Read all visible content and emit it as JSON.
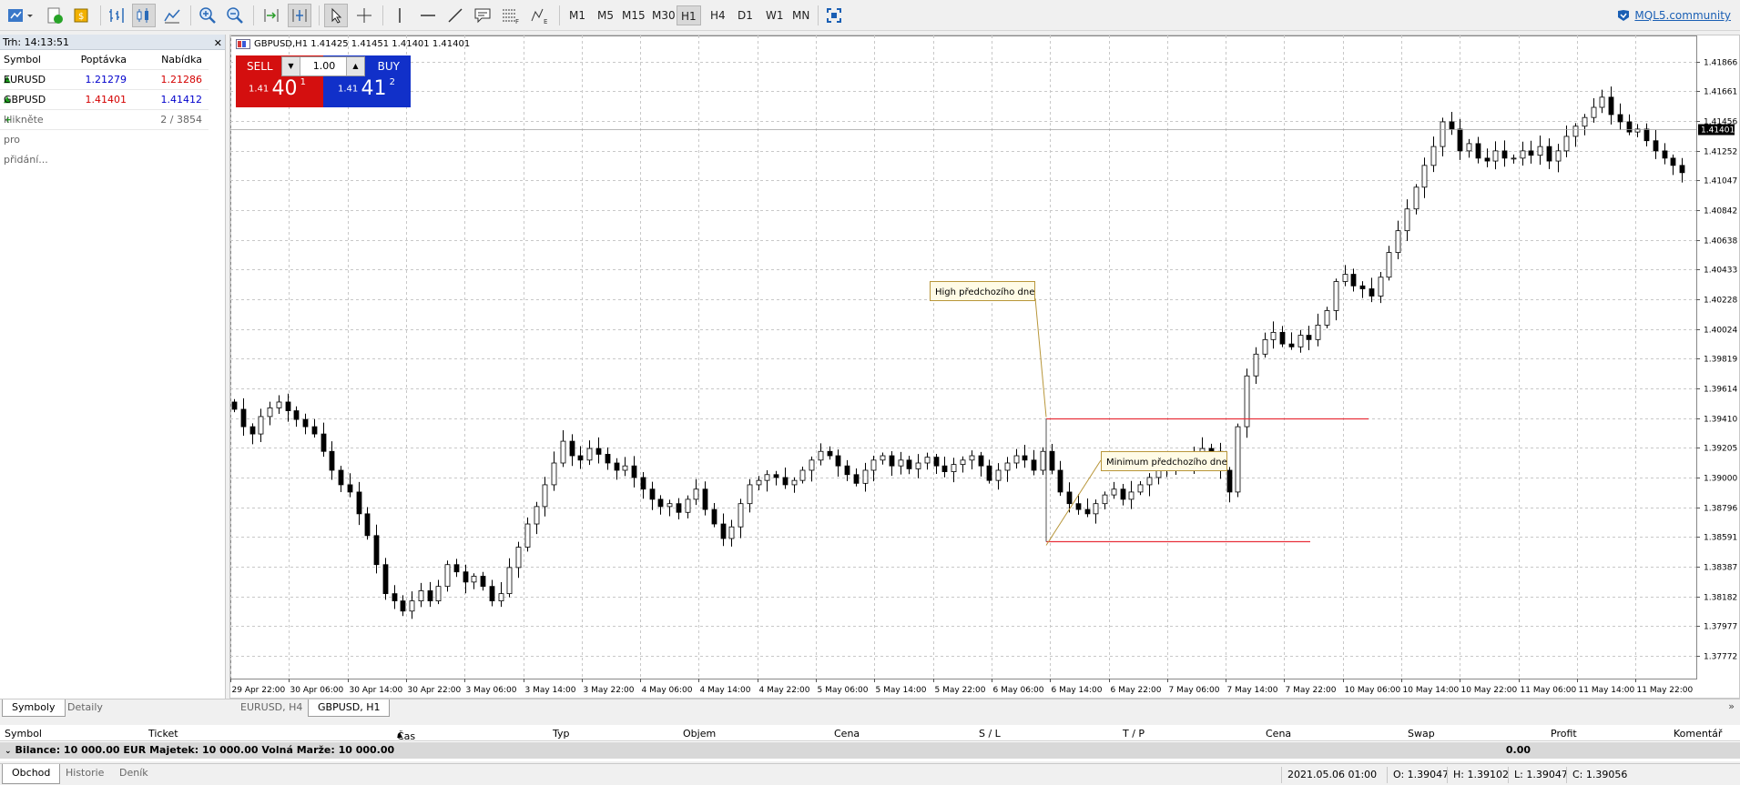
{
  "toolbar": {
    "timeframes": [
      "M1",
      "M5",
      "M15",
      "M30",
      "H1",
      "H4",
      "D1",
      "W1",
      "MN"
    ],
    "active_timeframe": "H1",
    "mql5_link": "MQL5.community"
  },
  "market_watch": {
    "title": "Trh: 14:13:51",
    "columns": [
      "Symbol",
      "Poptávka",
      "Nabídka"
    ],
    "rows": [
      {
        "symbol": "EURUSD",
        "bid": "1.21279",
        "ask": "1.21286"
      },
      {
        "symbol": "GBPUSD",
        "bid": "1.41401",
        "ask": "1.41412"
      }
    ],
    "add_text": "klikněte pro přidání...",
    "count": "2 / 3854"
  },
  "chart": {
    "header": "GBPUSD,H1  1.41425 1.41451 1.41401 1.41401",
    "sell_label": "SELL",
    "buy_label": "BUY",
    "lot": "1.00",
    "sell_prefix": "1.41",
    "sell_big": "40",
    "sell_sup": "1",
    "buy_prefix": "1.41",
    "buy_big": "41",
    "buy_sup": "2",
    "annotation_high": "High předchozího dne",
    "annotation_low": "Minimum předchozího dne"
  },
  "chart_data": {
    "type": "candlestick",
    "symbol": "GBPUSD",
    "timeframe": "H1",
    "current_price": "1.41401",
    "y_ticks": [
      "1.41866",
      "1.41661",
      "1.41456",
      "1.41252",
      "1.41047",
      "1.40842",
      "1.40638",
      "1.40433",
      "1.40228",
      "1.40024",
      "1.39819",
      "1.39614",
      "1.39410",
      "1.39205",
      "1.39000",
      "1.38796",
      "1.38591",
      "1.38387",
      "1.38182",
      "1.37977",
      "1.37772"
    ],
    "ylim": [
      1.37615,
      1.42045
    ],
    "x_ticks": [
      "29 Apr 22:00",
      "30 Apr 06:00",
      "30 Apr 14:00",
      "30 Apr 22:00",
      "3 May 06:00",
      "3 May 14:00",
      "3 May 22:00",
      "4 May 06:00",
      "4 May 14:00",
      "4 May 22:00",
      "5 May 06:00",
      "5 May 14:00",
      "5 May 22:00",
      "6 May 06:00",
      "6 May 14:00",
      "6 May 22:00",
      "7 May 06:00",
      "7 May 14:00",
      "7 May 22:00",
      "10 May 06:00",
      "10 May 14:00",
      "10 May 22:00",
      "11 May 06:00",
      "11 May 14:00",
      "11 May 22:00"
    ],
    "prev_day_high": 1.3941,
    "prev_day_low": 1.3856,
    "closes": [
      1.3947,
      1.3935,
      1.393,
      1.3942,
      1.3948,
      1.3952,
      1.3946,
      1.394,
      1.3935,
      1.393,
      1.3918,
      1.3905,
      1.3895,
      1.389,
      1.3875,
      1.386,
      1.384,
      1.382,
      1.3815,
      1.3808,
      1.3815,
      1.3822,
      1.3815,
      1.3825,
      1.384,
      1.3835,
      1.3828,
      1.3832,
      1.3825,
      1.3815,
      1.382,
      1.3838,
      1.3852,
      1.3868,
      1.388,
      1.3895,
      1.391,
      1.3925,
      1.3915,
      1.3912,
      1.392,
      1.3916,
      1.391,
      1.3905,
      1.3908,
      1.39,
      1.3892,
      1.3885,
      1.388,
      1.3882,
      1.3876,
      1.3885,
      1.3892,
      1.3878,
      1.3868,
      1.3858,
      1.3866,
      1.3882,
      1.3895,
      1.3898,
      1.3902,
      1.39,
      1.3895,
      1.3898,
      1.3905,
      1.3912,
      1.3918,
      1.3915,
      1.3908,
      1.3902,
      1.3896,
      1.3905,
      1.3912,
      1.3915,
      1.3908,
      1.3912,
      1.3906,
      1.391,
      1.3914,
      1.3908,
      1.3904,
      1.3909,
      1.3912,
      1.3915,
      1.3908,
      1.3898,
      1.3905,
      1.391,
      1.3915,
      1.3912,
      1.3905,
      1.3918,
      1.3905,
      1.389,
      1.3882,
      1.3878,
      1.3875,
      1.3882,
      1.3888,
      1.3892,
      1.3885,
      1.389,
      1.3895,
      1.39,
      1.3905,
      1.3908,
      1.3912,
      1.391,
      1.3915,
      1.392,
      1.3918,
      1.3905,
      1.389,
      1.3935,
      1.397,
      1.3985,
      1.3995,
      1.4,
      1.3992,
      1.399,
      1.3998,
      1.3995,
      1.4005,
      1.4015,
      1.4035,
      1.404,
      1.4032,
      1.403,
      1.4025,
      1.4038,
      1.4055,
      1.407,
      1.4085,
      1.41,
      1.4115,
      1.4128,
      1.4145,
      1.414,
      1.4125,
      1.413,
      1.412,
      1.4118,
      1.4125,
      1.412,
      1.412,
      1.4125,
      1.4122,
      1.4128,
      1.4118,
      1.4125,
      1.4135,
      1.4142,
      1.4148,
      1.4155,
      1.4162,
      1.415,
      1.4145,
      1.4138,
      1.414,
      1.4132,
      1.4125,
      1.412,
      1.4115,
      1.411
    ]
  },
  "tabs": {
    "panel": [
      "Symboly",
      "Detaily"
    ],
    "charts": [
      "EURUSD, H4",
      "GBPUSD, H1"
    ]
  },
  "terminal": {
    "columns": [
      "Symbol",
      "Ticket",
      "Čas",
      "Typ",
      "Objem",
      "Cena",
      "S / L",
      "T / P",
      "Cena",
      "Swap",
      "Profit",
      "Komentář"
    ],
    "balance": "Bilance: 10 000.00 EUR  Majetek: 10 000.00  Volná Marže: 10 000.00",
    "profit": "0.00",
    "tabs": [
      "Obchod",
      "Historie",
      "Deník"
    ]
  },
  "status": {
    "datetime": "2021.05.06 01:00",
    "open": "O: 1.39047",
    "high": "H: 1.39102",
    "low": "L: 1.39047",
    "close": "C: 1.39056"
  }
}
